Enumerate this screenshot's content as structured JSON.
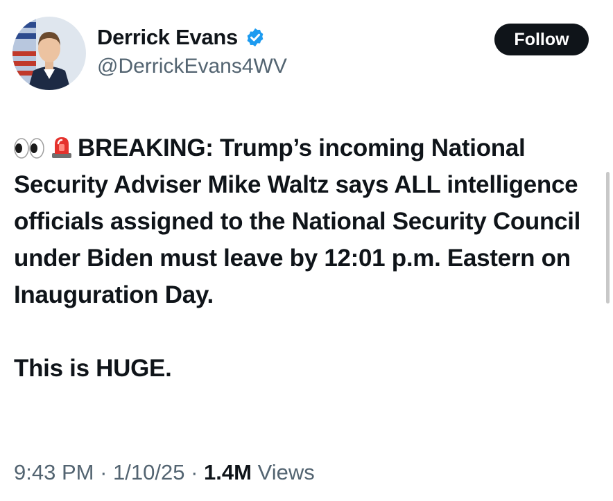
{
  "author": {
    "display_name": "Derrick Evans",
    "handle": "@DerrickEvans4WV",
    "verified": true,
    "avatar_icon": "profile-photo",
    "verified_icon": "verified-badge-icon"
  },
  "follow_button": {
    "label": "Follow"
  },
  "post": {
    "emojis": [
      "eyes-emoji",
      "police-light-emoji"
    ],
    "paragraph1": "BREAKING: Trump’s incoming National Security Adviser Mike Waltz says ALL intelligence officials assigned to the National Security Council under Biden must leave by 12:01 p.m. Eastern on Inauguration Day.",
    "paragraph2": "This is HUGE."
  },
  "meta": {
    "time": "9:43 PM",
    "separator": "·",
    "date": "1/10/25",
    "views_count": "1.4M",
    "views_label": "Views"
  },
  "colors": {
    "text": "#0f1419",
    "secondary": "#536471",
    "verified_blue": "#1d9bf0",
    "button_bg": "#0f1419",
    "button_text": "#ffffff"
  }
}
